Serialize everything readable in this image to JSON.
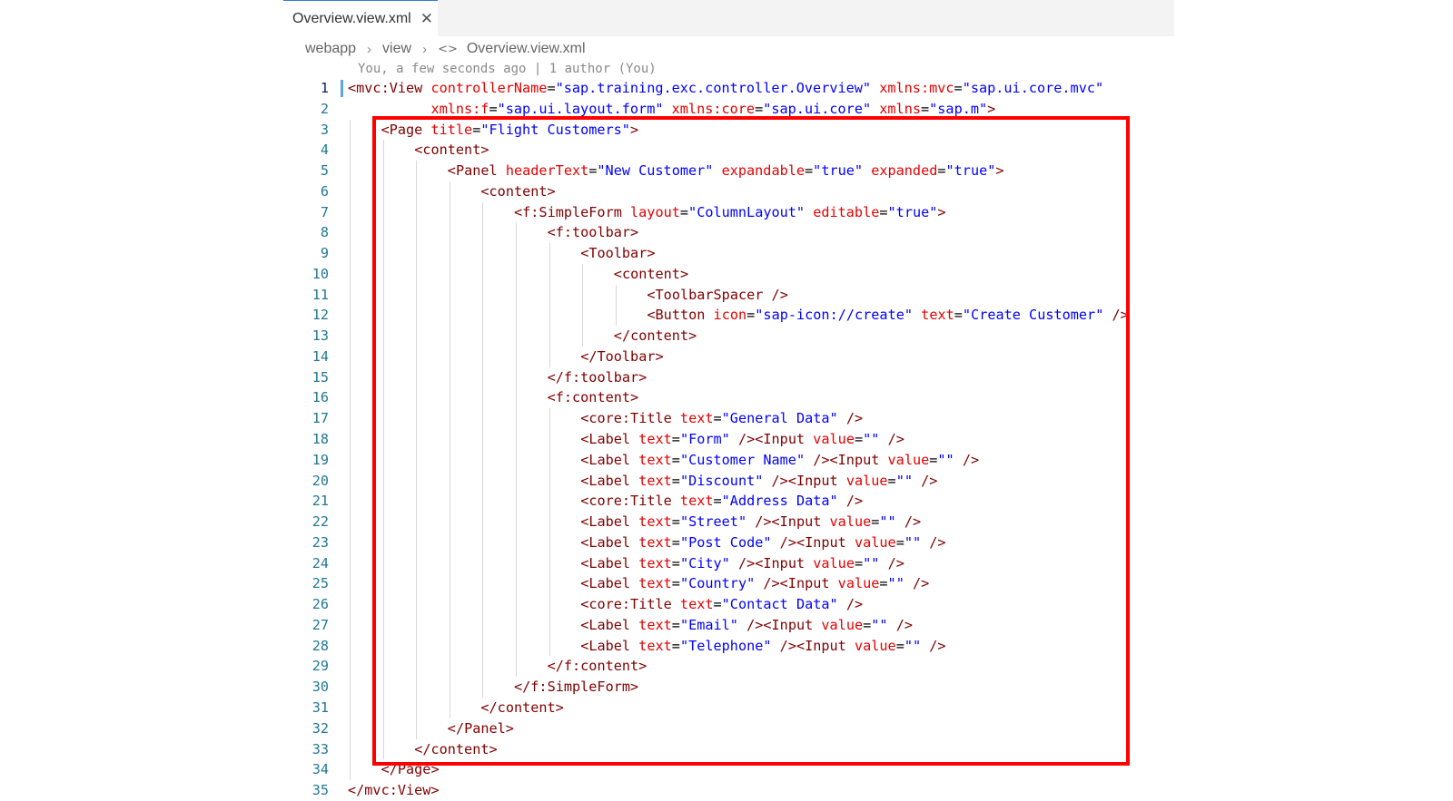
{
  "tab": {
    "title": "Overview.view.xml",
    "close_glyph": "✕"
  },
  "breadcrumb": {
    "items": [
      "webapp",
      "view"
    ],
    "file": "Overview.view.xml",
    "separator": "›"
  },
  "blame": "You, a few seconds ago | 1 author (You)",
  "colors": {
    "tag": "#800000",
    "attribute": "#e50000",
    "value": "#0000ff",
    "line_number": "#237893",
    "highlight_box": "#ff0000"
  },
  "code_lines": [
    {
      "n": "1",
      "indent": 0,
      "tokens": [
        [
          "t",
          "<mvc:View "
        ],
        [
          "a",
          "controllerName"
        ],
        [
          "p",
          "="
        ],
        [
          "v",
          "\"sap.training.exc.controller.Overview\""
        ],
        [
          "p",
          " "
        ],
        [
          "a",
          "xmlns:mvc"
        ],
        [
          "p",
          "="
        ],
        [
          "v",
          "\"sap.ui.core.mvc\""
        ]
      ]
    },
    {
      "n": "2",
      "indent": 0,
      "tokens": [
        [
          "p",
          "          "
        ],
        [
          "a",
          "xmlns:f"
        ],
        [
          "p",
          "="
        ],
        [
          "v",
          "\"sap.ui.layout.form\""
        ],
        [
          "p",
          " "
        ],
        [
          "a",
          "xmlns:core"
        ],
        [
          "p",
          "="
        ],
        [
          "v",
          "\"sap.ui.core\""
        ],
        [
          "p",
          " "
        ],
        [
          "a",
          "xmlns"
        ],
        [
          "p",
          "="
        ],
        [
          "v",
          "\"sap.m\""
        ],
        [
          "t",
          ">"
        ]
      ]
    },
    {
      "n": "3",
      "indent": 1,
      "tokens": [
        [
          "t",
          "<Page "
        ],
        [
          "a",
          "title"
        ],
        [
          "p",
          "="
        ],
        [
          "v",
          "\"Flight Customers\""
        ],
        [
          "t",
          ">"
        ]
      ]
    },
    {
      "n": "4",
      "indent": 2,
      "tokens": [
        [
          "t",
          "<content>"
        ]
      ]
    },
    {
      "n": "5",
      "indent": 3,
      "tokens": [
        [
          "t",
          "<Panel "
        ],
        [
          "a",
          "headerText"
        ],
        [
          "p",
          "="
        ],
        [
          "v",
          "\"New Customer\""
        ],
        [
          "p",
          " "
        ],
        [
          "a",
          "expandable"
        ],
        [
          "p",
          "="
        ],
        [
          "v",
          "\"true\""
        ],
        [
          "p",
          " "
        ],
        [
          "a",
          "expanded"
        ],
        [
          "p",
          "="
        ],
        [
          "v",
          "\"true\""
        ],
        [
          "t",
          ">"
        ]
      ]
    },
    {
      "n": "6",
      "indent": 4,
      "tokens": [
        [
          "t",
          "<content>"
        ]
      ]
    },
    {
      "n": "7",
      "indent": 5,
      "tokens": [
        [
          "t",
          "<f:SimpleForm "
        ],
        [
          "a",
          "layout"
        ],
        [
          "p",
          "="
        ],
        [
          "v",
          "\"ColumnLayout\""
        ],
        [
          "p",
          " "
        ],
        [
          "a",
          "editable"
        ],
        [
          "p",
          "="
        ],
        [
          "v",
          "\"true\""
        ],
        [
          "t",
          ">"
        ]
      ]
    },
    {
      "n": "8",
      "indent": 6,
      "tokens": [
        [
          "t",
          "<f:toolbar>"
        ]
      ]
    },
    {
      "n": "9",
      "indent": 7,
      "tokens": [
        [
          "t",
          "<Toolbar>"
        ]
      ]
    },
    {
      "n": "10",
      "indent": 8,
      "tokens": [
        [
          "t",
          "<content>"
        ]
      ]
    },
    {
      "n": "11",
      "indent": 9,
      "tokens": [
        [
          "t",
          "<ToolbarSpacer />"
        ]
      ]
    },
    {
      "n": "12",
      "indent": 9,
      "tokens": [
        [
          "t",
          "<Button "
        ],
        [
          "a",
          "icon"
        ],
        [
          "p",
          "="
        ],
        [
          "v",
          "\"sap-icon://create\""
        ],
        [
          "p",
          " "
        ],
        [
          "a",
          "text"
        ],
        [
          "p",
          "="
        ],
        [
          "v",
          "\"Create Customer\""
        ],
        [
          "t",
          " />"
        ]
      ]
    },
    {
      "n": "13",
      "indent": 8,
      "tokens": [
        [
          "t",
          "</content>"
        ]
      ]
    },
    {
      "n": "14",
      "indent": 7,
      "tokens": [
        [
          "t",
          "</Toolbar>"
        ]
      ]
    },
    {
      "n": "15",
      "indent": 6,
      "tokens": [
        [
          "t",
          "</f:toolbar>"
        ]
      ]
    },
    {
      "n": "16",
      "indent": 6,
      "tokens": [
        [
          "t",
          "<f:content>"
        ]
      ]
    },
    {
      "n": "17",
      "indent": 7,
      "tokens": [
        [
          "t",
          "<core:Title "
        ],
        [
          "a",
          "text"
        ],
        [
          "p",
          "="
        ],
        [
          "v",
          "\"General Data\""
        ],
        [
          "t",
          " />"
        ]
      ]
    },
    {
      "n": "18",
      "indent": 7,
      "tokens": [
        [
          "t",
          "<Label "
        ],
        [
          "a",
          "text"
        ],
        [
          "p",
          "="
        ],
        [
          "v",
          "\"Form\""
        ],
        [
          "t",
          " /><Input "
        ],
        [
          "a",
          "value"
        ],
        [
          "p",
          "="
        ],
        [
          "v",
          "\"\""
        ],
        [
          "t",
          " />"
        ]
      ]
    },
    {
      "n": "19",
      "indent": 7,
      "tokens": [
        [
          "t",
          "<Label "
        ],
        [
          "a",
          "text"
        ],
        [
          "p",
          "="
        ],
        [
          "v",
          "\"Customer Name\""
        ],
        [
          "t",
          " /><Input "
        ],
        [
          "a",
          "value"
        ],
        [
          "p",
          "="
        ],
        [
          "v",
          "\"\""
        ],
        [
          "t",
          " />"
        ]
      ]
    },
    {
      "n": "20",
      "indent": 7,
      "tokens": [
        [
          "t",
          "<Label "
        ],
        [
          "a",
          "text"
        ],
        [
          "p",
          "="
        ],
        [
          "v",
          "\"Discount\""
        ],
        [
          "t",
          " /><Input "
        ],
        [
          "a",
          "value"
        ],
        [
          "p",
          "="
        ],
        [
          "v",
          "\"\""
        ],
        [
          "t",
          " />"
        ]
      ]
    },
    {
      "n": "21",
      "indent": 7,
      "tokens": [
        [
          "t",
          "<core:Title "
        ],
        [
          "a",
          "text"
        ],
        [
          "p",
          "="
        ],
        [
          "v",
          "\"Address Data\""
        ],
        [
          "t",
          " />"
        ]
      ]
    },
    {
      "n": "22",
      "indent": 7,
      "tokens": [
        [
          "t",
          "<Label "
        ],
        [
          "a",
          "text"
        ],
        [
          "p",
          "="
        ],
        [
          "v",
          "\"Street\""
        ],
        [
          "t",
          " /><Input "
        ],
        [
          "a",
          "value"
        ],
        [
          "p",
          "="
        ],
        [
          "v",
          "\"\""
        ],
        [
          "t",
          " />"
        ]
      ]
    },
    {
      "n": "23",
      "indent": 7,
      "tokens": [
        [
          "t",
          "<Label "
        ],
        [
          "a",
          "text"
        ],
        [
          "p",
          "="
        ],
        [
          "v",
          "\"Post Code\""
        ],
        [
          "t",
          " /><Input "
        ],
        [
          "a",
          "value"
        ],
        [
          "p",
          "="
        ],
        [
          "v",
          "\"\""
        ],
        [
          "t",
          " />"
        ]
      ]
    },
    {
      "n": "24",
      "indent": 7,
      "tokens": [
        [
          "t",
          "<Label "
        ],
        [
          "a",
          "text"
        ],
        [
          "p",
          "="
        ],
        [
          "v",
          "\"City\""
        ],
        [
          "t",
          " /><Input "
        ],
        [
          "a",
          "value"
        ],
        [
          "p",
          "="
        ],
        [
          "v",
          "\"\""
        ],
        [
          "t",
          " />"
        ]
      ]
    },
    {
      "n": "25",
      "indent": 7,
      "tokens": [
        [
          "t",
          "<Label "
        ],
        [
          "a",
          "text"
        ],
        [
          "p",
          "="
        ],
        [
          "v",
          "\"Country\""
        ],
        [
          "t",
          " /><Input "
        ],
        [
          "a",
          "value"
        ],
        [
          "p",
          "="
        ],
        [
          "v",
          "\"\""
        ],
        [
          "t",
          " />"
        ]
      ]
    },
    {
      "n": "26",
      "indent": 7,
      "tokens": [
        [
          "t",
          "<core:Title "
        ],
        [
          "a",
          "text"
        ],
        [
          "p",
          "="
        ],
        [
          "v",
          "\"Contact Data\""
        ],
        [
          "t",
          " />"
        ]
      ]
    },
    {
      "n": "27",
      "indent": 7,
      "tokens": [
        [
          "t",
          "<Label "
        ],
        [
          "a",
          "text"
        ],
        [
          "p",
          "="
        ],
        [
          "v",
          "\"Email\""
        ],
        [
          "t",
          " /><Input "
        ],
        [
          "a",
          "value"
        ],
        [
          "p",
          "="
        ],
        [
          "v",
          "\"\""
        ],
        [
          "t",
          " />"
        ]
      ]
    },
    {
      "n": "28",
      "indent": 7,
      "tokens": [
        [
          "t",
          "<Label "
        ],
        [
          "a",
          "text"
        ],
        [
          "p",
          "="
        ],
        [
          "v",
          "\"Telephone\""
        ],
        [
          "t",
          " /><Input "
        ],
        [
          "a",
          "value"
        ],
        [
          "p",
          "="
        ],
        [
          "v",
          "\"\""
        ],
        [
          "t",
          " />"
        ]
      ]
    },
    {
      "n": "29",
      "indent": 6,
      "tokens": [
        [
          "t",
          "</f:content>"
        ]
      ]
    },
    {
      "n": "30",
      "indent": 5,
      "tokens": [
        [
          "t",
          "</f:SimpleForm>"
        ]
      ]
    },
    {
      "n": "31",
      "indent": 4,
      "tokens": [
        [
          "t",
          "</content>"
        ]
      ]
    },
    {
      "n": "32",
      "indent": 3,
      "tokens": [
        [
          "t",
          "</Panel>"
        ]
      ]
    },
    {
      "n": "33",
      "indent": 2,
      "tokens": [
        [
          "t",
          "</content>"
        ]
      ]
    },
    {
      "n": "34",
      "indent": 1,
      "tokens": [
        [
          "t",
          "</Page>"
        ]
      ]
    },
    {
      "n": "35",
      "indent": 0,
      "tokens": [
        [
          "t",
          "</mvc:View>"
        ]
      ]
    }
  ]
}
